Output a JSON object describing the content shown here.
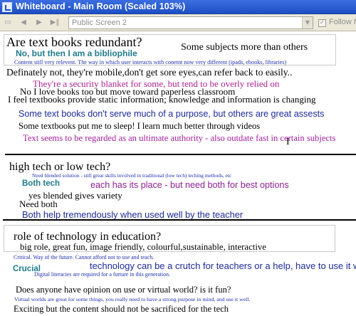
{
  "window": {
    "title": "Whiteboard - Main Room (Scaled 103%)"
  },
  "toolbar": {
    "screen_value": "Public Screen 2",
    "follow_label": "Follow Mo",
    "follow_checked": true
  },
  "whiteboard": {
    "lines": [
      {
        "text": "Are text books redundant?",
        "color": "#000000"
      },
      {
        "text": "Some subjects more than others",
        "color": "#000000"
      },
      {
        "text": "No, but then I am a bibliophile",
        "color": "#1f7a8c"
      },
      {
        "text": "Content still very relevent. The way in which user interacts with conetnt now very different (ipads, ebooks, libraries)",
        "color": "#1d2fb0"
      },
      {
        "text": "Definately not, they're mobile,don't get sore eyes,can refer back to easily..",
        "color": "#000000"
      },
      {
        "text": "They're a security blanket for some, but tend to be overly relied on",
        "color": "#b01e92"
      },
      {
        "text": "No I love books too but move toward paperless classroom",
        "color": "#000000"
      },
      {
        "text": "I feel textbooks provide static information; knowledge and information is changing",
        "color": "#000000"
      },
      {
        "text": "Some text books don't serve much of a purpose, but others are great assests",
        "color": "#1c2a9a"
      },
      {
        "text": "Some textbooks put me to sleep! I learn much better through videos",
        "color": "#000000"
      },
      {
        "text": "Text seems to be regarded as an ultimate authority - also outdate fast in certain subjects",
        "color": "#a21ea0"
      },
      {
        "text": "high tech or low tech?",
        "color": "#000000"
      },
      {
        "text": "Need blended solution - still great skills involved in traditional (low tech) teching methods, etc",
        "color": "#1d2fb0"
      },
      {
        "text": "Both tech",
        "color": "#1f7a8c"
      },
      {
        "text": "each has its place - but need both for best options",
        "color": "#8e1f92"
      },
      {
        "text": "yes blended gives variety",
        "color": "#000000"
      },
      {
        "text": "Need both",
        "color": "#000000"
      },
      {
        "text": "Both help tremendously when used well by the teacher",
        "color": "#1c2a9a"
      },
      {
        "text": "role of technology in education?",
        "color": "#000000"
      },
      {
        "text": "big role, great fun, image friendly, colourful,sustainable, interactive",
        "color": "#000000"
      },
      {
        "text": "Critical. Way of the future. Cannot afford not to use and teach.",
        "color": "#1d2fb0"
      },
      {
        "text": "Crucial",
        "color": "#1f7a8c"
      },
      {
        "text": "technology can be a crutch for teachers or a help, have to use it well",
        "color": "#1c2a9a"
      },
      {
        "text": "Digital literacies are required for a furture in this generation.",
        "color": "#1d2fb0"
      },
      {
        "text": "Does anyone have opinion on use or virtual world? is it fun?",
        "color": "#000000"
      },
      {
        "text": "Virtual worlds are great for some things, you really need to have a strong purpose in mind, and use it well.",
        "color": "#1d2fb0"
      },
      {
        "text": "Exciting but the content should not be sacrificed for the tech",
        "color": "#000000"
      }
    ]
  }
}
